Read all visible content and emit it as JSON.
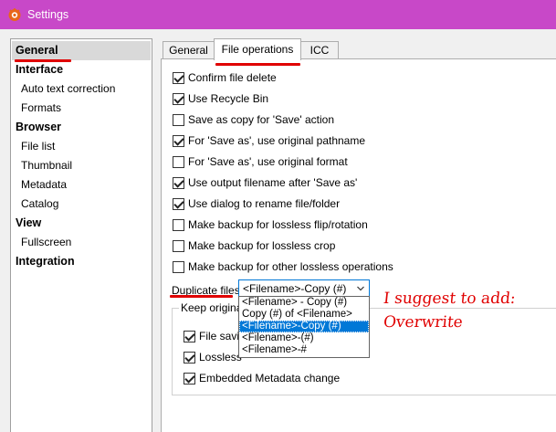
{
  "window": {
    "title": "Settings"
  },
  "nav": {
    "items": [
      {
        "label": "General",
        "kind": "group",
        "selected": true
      },
      {
        "label": "Interface",
        "kind": "group"
      },
      {
        "label": "Auto text correction",
        "kind": "sub"
      },
      {
        "label": "Formats",
        "kind": "sub"
      },
      {
        "label": "Browser",
        "kind": "group"
      },
      {
        "label": "File list",
        "kind": "sub"
      },
      {
        "label": "Thumbnail",
        "kind": "sub"
      },
      {
        "label": "Metadata",
        "kind": "sub"
      },
      {
        "label": "Catalog",
        "kind": "sub"
      },
      {
        "label": "View",
        "kind": "group"
      },
      {
        "label": "Fullscreen",
        "kind": "sub"
      },
      {
        "label": "Integration",
        "kind": "group"
      }
    ]
  },
  "tabs": [
    {
      "label": "General",
      "active": false
    },
    {
      "label": "File operations",
      "active": true
    },
    {
      "label": "ICC",
      "active": false
    }
  ],
  "options": [
    {
      "label": "Confirm file delete",
      "checked": true
    },
    {
      "label": "Use Recycle Bin",
      "checked": true
    },
    {
      "label": "Save as copy for 'Save' action",
      "checked": false
    },
    {
      "label": "For 'Save as', use original pathname",
      "checked": true
    },
    {
      "label": "For 'Save as', use original format",
      "checked": false
    },
    {
      "label": "Use output filename after 'Save as'",
      "checked": true
    },
    {
      "label": "Use dialog to rename file/folder",
      "checked": true
    },
    {
      "label": "Make backup for lossless flip/rotation",
      "checked": false
    },
    {
      "label": "Make backup for lossless crop",
      "checked": false
    },
    {
      "label": "Make backup for other lossless operations",
      "checked": false
    }
  ],
  "duplicate_files": {
    "label": "Duplicate files",
    "selected_value": "<Filename>-Copy (#)",
    "options": [
      {
        "label": "<Filename> - Copy (#)",
        "selected": false
      },
      {
        "label": "Copy (#) of <Filename>",
        "selected": false
      },
      {
        "label": "<Filename>-Copy (#)",
        "selected": true
      },
      {
        "label": "<Filename>-(#)",
        "selected": false
      },
      {
        "label": "<Filename>-#",
        "selected": false
      }
    ]
  },
  "keep_original": {
    "title": "Keep original",
    "items": [
      {
        "label": "File savin",
        "checked": true
      },
      {
        "label": "Lossless",
        "checked": true
      },
      {
        "label": "Embedded Metadata change",
        "checked": true
      }
    ]
  },
  "annotation": {
    "line1": "I suggest to add:",
    "line2": "Overwrite",
    "color": "#e00000"
  },
  "colors": {
    "titlebar": "#c848c8",
    "selection": "#0078d7"
  }
}
